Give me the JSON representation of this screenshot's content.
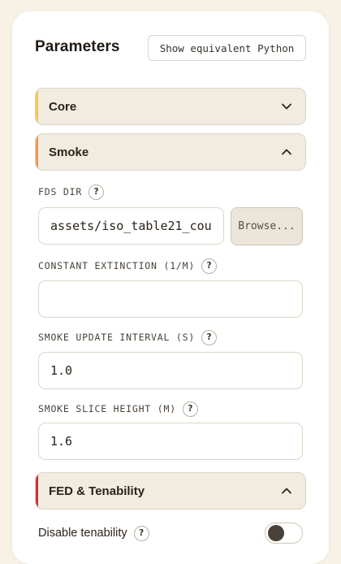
{
  "header": {
    "title": "Parameters",
    "python_button": "Show equivalent Python"
  },
  "sections": {
    "core": {
      "label": "Core",
      "state": "collapsed",
      "accent": "#f2c94c",
      "icon": "chevron-down-icon"
    },
    "smoke": {
      "label": "Smoke",
      "state": "expanded",
      "accent": "#f0954a",
      "icon": "chevron-up-icon"
    },
    "fed": {
      "label": "FED & Tenability",
      "state": "expanded",
      "accent": "#c8343a",
      "icon": "chevron-up-icon"
    }
  },
  "smoke": {
    "fds_dir": {
      "label": "FDS DIR",
      "value": "assets/iso_table21_cou",
      "browse_label": "Browse..."
    },
    "constant_extinction": {
      "label": "CONSTANT EXTINCTION (1/M)",
      "value": ""
    },
    "update_interval": {
      "label": "SMOKE UPDATE INTERVAL (S)",
      "value": "1.0"
    },
    "slice_height": {
      "label": "SMOKE SLICE HEIGHT (M)",
      "value": "1.6"
    }
  },
  "fed": {
    "disable_tenability": {
      "label": "Disable tenability",
      "checked": false
    }
  },
  "help_glyph": "?"
}
